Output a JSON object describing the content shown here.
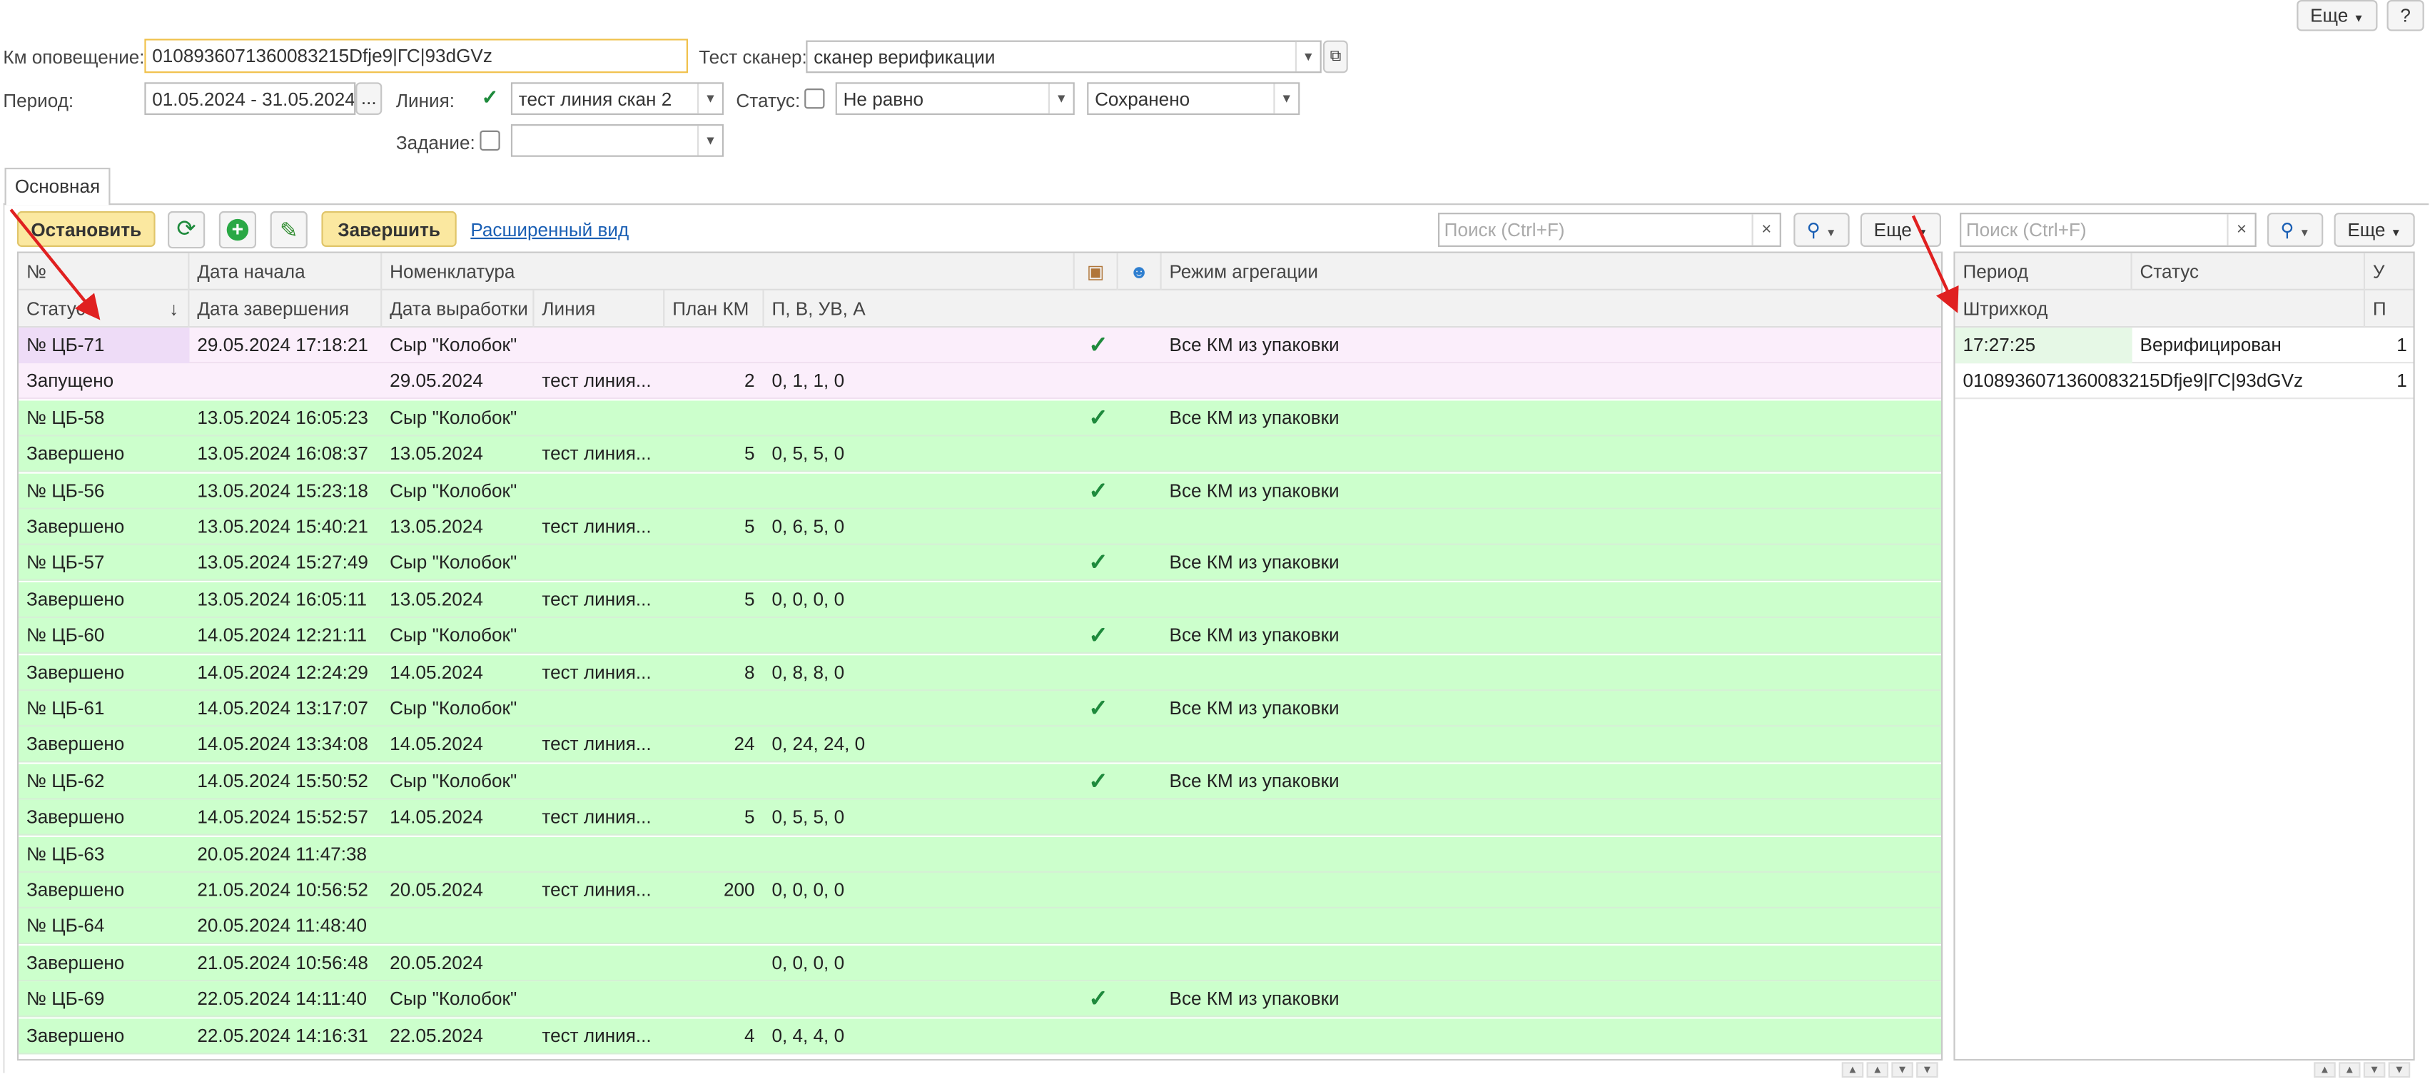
{
  "top_buttons": {
    "more": "Еще",
    "help": "?"
  },
  "filters": {
    "km_label": "Км оповещение:",
    "km_value": "0108936071360083215Dfje9|ГС|93dGVz",
    "scanner_label": "Тест сканер:",
    "scanner_value": "сканер верификации",
    "period_label": "Период:",
    "period_value": "01.05.2024 - 31.05.2024",
    "period_btn": "...",
    "line_label": "Линия:",
    "line_value": "тест линия скан 2",
    "status_label": "Статус:",
    "status_cond": "Не равно",
    "status_value": "Сохранено",
    "task_label": "Задание:",
    "task_value": ""
  },
  "tab": "Основная",
  "toolbar": {
    "stop": "Остановить",
    "finish": "Завершить",
    "extended": "Расширенный вид",
    "search_placeholder": "Поиск (Ctrl+F)",
    "more": "Еще",
    "clear": "×"
  },
  "left_table": {
    "headers_row1": [
      "№",
      "Дата начала",
      "Номенклатура",
      "",
      "",
      "Режим агрегации"
    ],
    "headers_row2": [
      "Статус",
      "Дата завершения",
      "Дата выработки",
      "Линия",
      "План КМ",
      "П, В, УВ, А"
    ],
    "sort_arrow": "↓",
    "rows": [
      {
        "a": "№ ЦБ-71",
        "b": "29.05.2024 17:18:21",
        "c": "Сыр \"Колобок\"",
        "d": "",
        "e": "",
        "f": "",
        "chk": "✓",
        "g": "Все КМ из упаковки",
        "sel": true
      },
      {
        "a": "Запущено",
        "b": "",
        "c": "29.05.2024",
        "d": "тест линия...",
        "e": "2",
        "f": "0, 1, 1, 0",
        "chk": "",
        "g": "",
        "sel": true
      },
      {
        "a": "№ ЦБ-58",
        "b": "13.05.2024 16:05:23",
        "c": "Сыр \"Колобок\"",
        "d": "",
        "e": "",
        "f": "",
        "chk": "✓",
        "g": "Все КМ из упаковки"
      },
      {
        "a": "Завершено",
        "b": "13.05.2024 16:08:37",
        "c": "13.05.2024",
        "d": "тест линия...",
        "e": "5",
        "f": "0, 5, 5, 0",
        "chk": "",
        "g": ""
      },
      {
        "a": "№ ЦБ-56",
        "b": "13.05.2024 15:23:18",
        "c": "Сыр \"Колобок\"",
        "d": "",
        "e": "",
        "f": "",
        "chk": "✓",
        "g": "Все КМ из упаковки"
      },
      {
        "a": "Завершено",
        "b": "13.05.2024 15:40:21",
        "c": "13.05.2024",
        "d": "тест линия...",
        "e": "5",
        "f": "0, 6, 5, 0",
        "chk": "",
        "g": ""
      },
      {
        "a": "№ ЦБ-57",
        "b": "13.05.2024 15:27:49",
        "c": "Сыр \"Колобок\"",
        "d": "",
        "e": "",
        "f": "",
        "chk": "✓",
        "g": "Все КМ из упаковки"
      },
      {
        "a": "Завершено",
        "b": "13.05.2024 16:05:11",
        "c": "13.05.2024",
        "d": "тест линия...",
        "e": "5",
        "f": "0, 0, 0, 0",
        "chk": "",
        "g": ""
      },
      {
        "a": "№ ЦБ-60",
        "b": "14.05.2024 12:21:11",
        "c": "Сыр \"Колобок\"",
        "d": "",
        "e": "",
        "f": "",
        "chk": "✓",
        "g": "Все КМ из упаковки"
      },
      {
        "a": "Завершено",
        "b": "14.05.2024 12:24:29",
        "c": "14.05.2024",
        "d": "тест линия...",
        "e": "8",
        "f": "0, 8, 8, 0",
        "chk": "",
        "g": ""
      },
      {
        "a": "№ ЦБ-61",
        "b": "14.05.2024 13:17:07",
        "c": "Сыр \"Колобок\"",
        "d": "",
        "e": "",
        "f": "",
        "chk": "✓",
        "g": "Все КМ из упаковки"
      },
      {
        "a": "Завершено",
        "b": "14.05.2024 13:34:08",
        "c": "14.05.2024",
        "d": "тест линия...",
        "e": "24",
        "f": "0, 24, 24, 0",
        "chk": "",
        "g": ""
      },
      {
        "a": "№ ЦБ-62",
        "b": "14.05.2024 15:50:52",
        "c": "Сыр \"Колобок\"",
        "d": "",
        "e": "",
        "f": "",
        "chk": "✓",
        "g": "Все КМ из упаковки"
      },
      {
        "a": "Завершено",
        "b": "14.05.2024 15:52:57",
        "c": "14.05.2024",
        "d": "тест линия...",
        "e": "5",
        "f": "0, 5, 5, 0",
        "chk": "",
        "g": ""
      },
      {
        "a": "№ ЦБ-63",
        "b": "20.05.2024 11:47:38",
        "c": "",
        "d": "",
        "e": "",
        "f": "",
        "chk": "",
        "g": ""
      },
      {
        "a": "Завершено",
        "b": "21.05.2024 10:56:52",
        "c": "20.05.2024",
        "d": "тест линия...",
        "e": "200",
        "f": "0, 0, 0, 0",
        "chk": "",
        "g": ""
      },
      {
        "a": "№ ЦБ-64",
        "b": "20.05.2024 11:48:40",
        "c": "",
        "d": "",
        "e": "",
        "f": "",
        "chk": "",
        "g": ""
      },
      {
        "a": "Завершено",
        "b": "21.05.2024 10:56:48",
        "c": "20.05.2024",
        "d": "",
        "e": "",
        "f": "0, 0, 0, 0",
        "chk": "",
        "g": ""
      },
      {
        "a": "№ ЦБ-69",
        "b": "22.05.2024 14:11:40",
        "c": "Сыр \"Колобок\"",
        "d": "",
        "e": "",
        "f": "",
        "chk": "✓",
        "g": "Все КМ из упаковки"
      },
      {
        "a": "Завершено",
        "b": "22.05.2024 14:16:31",
        "c": "22.05.2024",
        "d": "тест линия...",
        "e": "4",
        "f": "0, 4, 4, 0",
        "chk": "",
        "g": ""
      }
    ]
  },
  "right_table": {
    "headers_row1": [
      "Период",
      "Статус",
      "У"
    ],
    "headers_row2": [
      "Штрихкод",
      "П"
    ],
    "rows": [
      {
        "a": "17:27:25",
        "b": "Верифицирован",
        "c": "1"
      },
      {
        "a": "0108936071360083215Dfje9|ГС|93dGVz",
        "b": "",
        "c": "1"
      }
    ]
  },
  "colors": {
    "row_green": "#ccffcc",
    "row_selected": "#fbeefb",
    "accent": "#f0c14b",
    "check": "#1e8a3c",
    "arrow": "#e02020"
  }
}
